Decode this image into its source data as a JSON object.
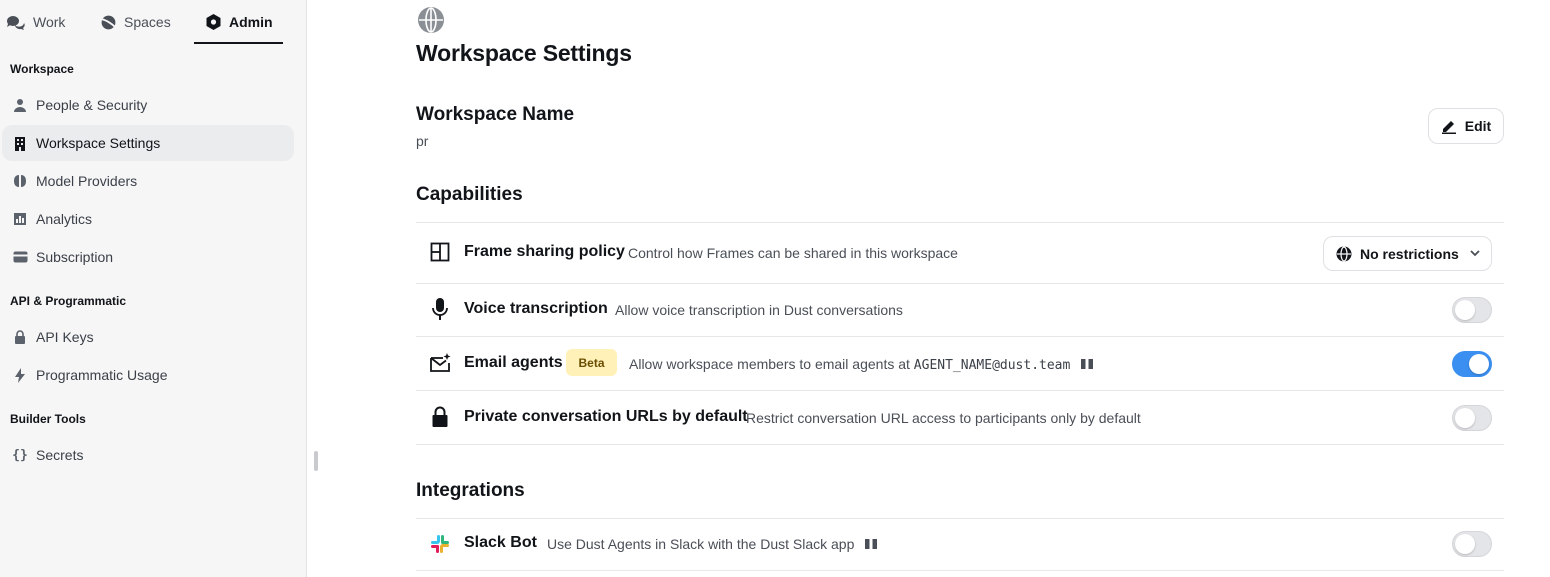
{
  "topnav": {
    "tabs": [
      {
        "label": "Work",
        "icon": "chat-bubbles-icon"
      },
      {
        "label": "Spaces",
        "icon": "planet-icon"
      },
      {
        "label": "Admin",
        "icon": "hexagon-icon",
        "active": true
      }
    ]
  },
  "sidebar": {
    "sections": [
      {
        "label": "Workspace"
      },
      {
        "label": "API & Programmatic"
      },
      {
        "label": "Builder Tools"
      }
    ],
    "items": [
      {
        "label": "People & Security",
        "icon": "user-icon"
      },
      {
        "label": "Workspace Settings",
        "icon": "building-icon",
        "active": true
      },
      {
        "label": "Model Providers",
        "icon": "brain-icon"
      },
      {
        "label": "Analytics",
        "icon": "bar-chart-icon"
      },
      {
        "label": "Subscription",
        "icon": "card-icon"
      },
      {
        "label": "API Keys",
        "icon": "lock-icon"
      },
      {
        "label": "Programmatic Usage",
        "icon": "lightning-icon"
      },
      {
        "label": "Secrets",
        "icon": "braces-icon",
        "glyph": "{}"
      }
    ]
  },
  "main": {
    "page_title": "Workspace Settings",
    "workspace_name": {
      "label": "Workspace Name",
      "value": "pr",
      "edit_label": "Edit"
    },
    "capabilities": {
      "heading": "Capabilities",
      "rows": [
        {
          "title": "Frame sharing policy",
          "desc": "Control how Frames can be shared in this workspace",
          "control": "select",
          "value": "No restrictions"
        },
        {
          "title": "Voice transcription",
          "desc": "Allow voice transcription in Dust conversations",
          "control": "toggle",
          "on": false
        },
        {
          "title": "Email agents",
          "badge": "Beta",
          "desc_prefix": "Allow workspace members to email agents at ",
          "desc_code": "AGENT_NAME@dust.team",
          "control": "toggle",
          "on": true
        },
        {
          "title": "Private conversation URLs by default",
          "desc": "Restrict conversation URL access to participants only by default",
          "control": "toggle",
          "on": false
        }
      ]
    },
    "integrations": {
      "heading": "Integrations",
      "rows": [
        {
          "title": "Slack Bot",
          "desc": "Use Dust Agents in Slack with the Dust Slack app",
          "control": "toggle",
          "on": false
        }
      ]
    }
  },
  "colors": {
    "accent": "#3b8ff0",
    "beta_bg": "#fff1b8",
    "sidebar_bg": "#f6f6f7"
  }
}
